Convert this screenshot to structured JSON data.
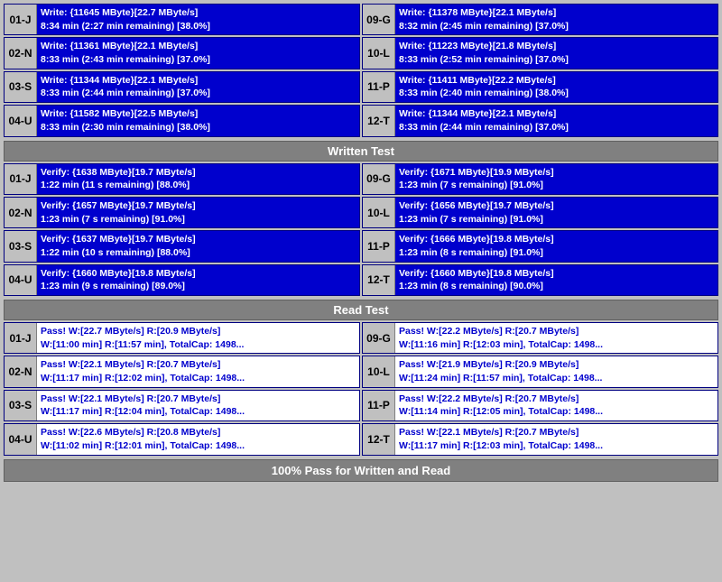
{
  "sections": {
    "written": {
      "label": "Written Test",
      "devices_left": [
        {
          "id": "01-J",
          "line1": "Write: {11645 MByte}[22.7 MByte/s]",
          "line2": "8:34 min (2:27 min remaining)  [38.0%]"
        },
        {
          "id": "02-N",
          "line1": "Write: {11361 MByte}[22.1 MByte/s]",
          "line2": "8:33 min (2:43 min remaining)  [37.0%]"
        },
        {
          "id": "03-S",
          "line1": "Write: {11344 MByte}[22.1 MByte/s]",
          "line2": "8:33 min (2:44 min remaining)  [37.0%]"
        },
        {
          "id": "04-U",
          "line1": "Write: {11582 MByte}[22.5 MByte/s]",
          "line2": "8:33 min (2:30 min remaining)  [38.0%]"
        }
      ],
      "devices_right": [
        {
          "id": "09-G",
          "line1": "Write: {11378 MByte}[22.1 MByte/s]",
          "line2": "8:32 min (2:45 min remaining)  [37.0%]"
        },
        {
          "id": "10-L",
          "line1": "Write: {11223 MByte}[21.8 MByte/s]",
          "line2": "8:33 min (2:52 min remaining)  [37.0%]"
        },
        {
          "id": "11-P",
          "line1": "Write: {11411 MByte}[22.2 MByte/s]",
          "line2": "8:33 min (2:40 min remaining)  [38.0%]"
        },
        {
          "id": "12-T",
          "line1": "Write: {11344 MByte}[22.1 MByte/s]",
          "line2": "8:33 min (2:44 min remaining)  [37.0%]"
        }
      ]
    },
    "verify": {
      "label": "Written Test",
      "devices_left": [
        {
          "id": "01-J",
          "line1": "Verify: {1638 MByte}[19.7 MByte/s]",
          "line2": "1:22 min (11 s remaining)  [88.0%]"
        },
        {
          "id": "02-N",
          "line1": "Verify: {1657 MByte}[19.7 MByte/s]",
          "line2": "1:23 min (7 s remaining)  [91.0%]"
        },
        {
          "id": "03-S",
          "line1": "Verify: {1637 MByte}[19.7 MByte/s]",
          "line2": "1:22 min (10 s remaining)  [88.0%]"
        },
        {
          "id": "04-U",
          "line1": "Verify: {1660 MByte}[19.8 MByte/s]",
          "line2": "1:23 min (9 s remaining)  [89.0%]"
        }
      ],
      "devices_right": [
        {
          "id": "09-G",
          "line1": "Verify: {1671 MByte}[19.9 MByte/s]",
          "line2": "1:23 min (7 s remaining)  [91.0%]"
        },
        {
          "id": "10-L",
          "line1": "Verify: {1656 MByte}[19.7 MByte/s]",
          "line2": "1:23 min (7 s remaining)  [91.0%]"
        },
        {
          "id": "11-P",
          "line1": "Verify: {1666 MByte}[19.8 MByte/s]",
          "line2": "1:23 min (8 s remaining)  [91.0%]"
        },
        {
          "id": "12-T",
          "line1": "Verify: {1660 MByte}[19.8 MByte/s]",
          "line2": "1:23 min (8 s remaining)  [90.0%]"
        }
      ]
    },
    "read": {
      "label": "Read Test",
      "devices_left": [
        {
          "id": "01-J",
          "line1": "Pass! W:[22.7 MByte/s] R:[20.9 MByte/s]",
          "line2": "W:[11:00 min] R:[11:57 min], TotalCap: 1498..."
        },
        {
          "id": "02-N",
          "line1": "Pass! W:[22.1 MByte/s] R:[20.7 MByte/s]",
          "line2": "W:[11:17 min] R:[12:02 min], TotalCap: 1498..."
        },
        {
          "id": "03-S",
          "line1": "Pass! W:[22.1 MByte/s] R:[20.7 MByte/s]",
          "line2": "W:[11:17 min] R:[12:04 min], TotalCap: 1498..."
        },
        {
          "id": "04-U",
          "line1": "Pass! W:[22.6 MByte/s] R:[20.8 MByte/s]",
          "line2": "W:[11:02 min] R:[12:01 min], TotalCap: 1498..."
        }
      ],
      "devices_right": [
        {
          "id": "09-G",
          "line1": "Pass! W:[22.2 MByte/s] R:[20.7 MByte/s]",
          "line2": "W:[11:16 min] R:[12:03 min], TotalCap: 1498..."
        },
        {
          "id": "10-L",
          "line1": "Pass! W:[21.9 MByte/s] R:[20.9 MByte/s]",
          "line2": "W:[11:24 min] R:[11:57 min], TotalCap: 1498..."
        },
        {
          "id": "11-P",
          "line1": "Pass! W:[22.2 MByte/s] R:[20.7 MByte/s]",
          "line2": "W:[11:14 min] R:[12:05 min], TotalCap: 1498..."
        },
        {
          "id": "12-T",
          "line1": "Pass! W:[22.1 MByte/s] R:[20.7 MByte/s]",
          "line2": "W:[11:17 min] R:[12:03 min], TotalCap: 1498..."
        }
      ]
    }
  },
  "labels": {
    "written_test": "Written Test",
    "read_test": "Read Test",
    "final_status": "100% Pass for Written and Read"
  }
}
